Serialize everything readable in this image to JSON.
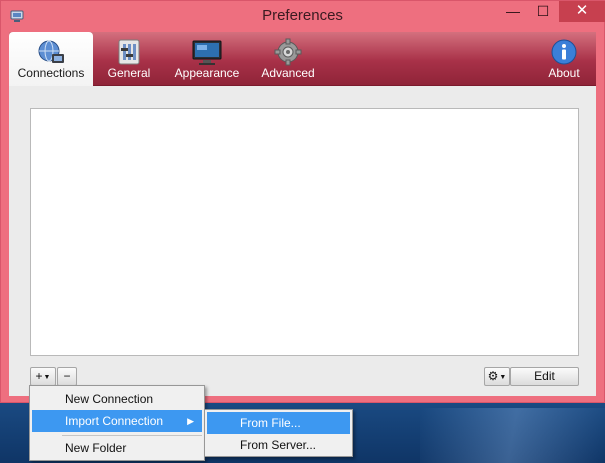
{
  "window": {
    "title": "Preferences",
    "minimize_glyph": "—",
    "maximize_glyph": "☐",
    "close_glyph": "✕"
  },
  "toolbar": {
    "items": [
      {
        "label": "Connections",
        "icon": "connections-icon",
        "active": true
      },
      {
        "label": "General",
        "icon": "general-icon",
        "active": false
      },
      {
        "label": "Appearance",
        "icon": "appearance-icon",
        "active": false
      },
      {
        "label": "Advanced",
        "icon": "advanced-gear-icon",
        "active": false
      },
      {
        "label": "About",
        "icon": "info-icon",
        "active": false
      }
    ]
  },
  "connections": {
    "items": [],
    "add_glyph": "+",
    "dropdown_glyph": "▼",
    "remove_glyph": "−",
    "gear_glyph": "⚙",
    "edit_label": "Edit"
  },
  "add_menu": {
    "items": [
      "New Connection",
      "Import Connection",
      "New Folder"
    ],
    "submenu_glyph": "▶",
    "import_submenu": [
      "From File...",
      "From Server..."
    ]
  },
  "colors": {
    "window_frame": "#ee6f7f",
    "toolbar": "#a83148",
    "menu_highlight": "#3d98f1"
  }
}
